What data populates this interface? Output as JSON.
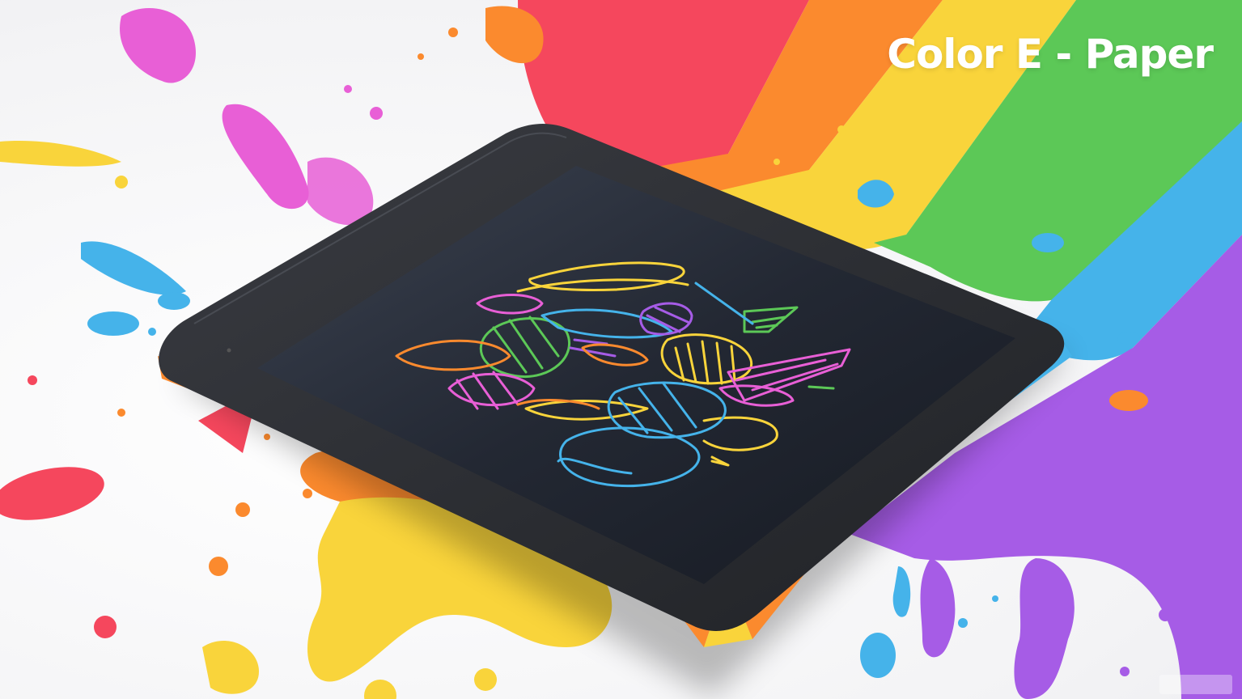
{
  "headline": "Color E - Paper",
  "palette": {
    "magenta": "#e85fd6",
    "red": "#f5475d",
    "orange": "#fb8a2e",
    "yellow": "#f9d43b",
    "green": "#5cc857",
    "blue": "#45b3ea",
    "purple": "#a65ce6",
    "device_bezel": "#2a2c31",
    "device_screen": "#1c2029"
  },
  "scene": {
    "subject": "color-e-paper-drawing-tablet",
    "background": "rainbow-paint-splash",
    "screen_content": "colorful-scribble-drawing"
  }
}
